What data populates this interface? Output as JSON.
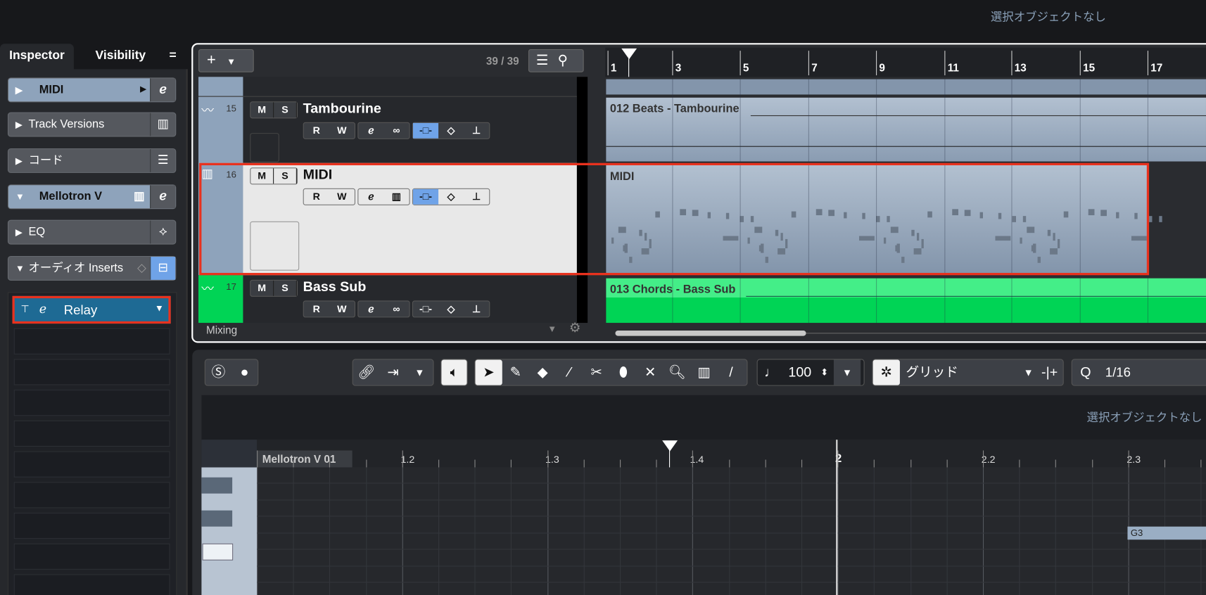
{
  "top_bar": {
    "selection_info": "選択オブジェクトなし"
  },
  "inspector": {
    "tabs": [
      {
        "label": "Inspector",
        "active": true
      },
      {
        "label": "Visibility",
        "active": false
      }
    ],
    "menu_icon": "hamburger-icon",
    "sections": [
      {
        "label": "MIDI",
        "expanded": false,
        "icon": "edit-e-icon"
      },
      {
        "label": "Track Versions",
        "expanded": false,
        "icon": "track-versions-icon"
      },
      {
        "label": "コード",
        "expanded": false,
        "icon": "chord-sliders-icon"
      },
      {
        "label": "Mellotron V",
        "expanded": true,
        "icon": "edit-e-icon"
      },
      {
        "label": "EQ",
        "expanded": false,
        "icon": "eq-icon"
      },
      {
        "label": "オーディオ Inserts",
        "expanded": true,
        "icon": "insert-icon"
      }
    ],
    "insert_slot": {
      "label": "Relay"
    }
  },
  "project": {
    "add_button": "+",
    "track_count": "39 / 39",
    "tracks": [
      {
        "number": "15",
        "name": "Tambourine",
        "type": "audio",
        "event": "012 Beats - Tambourine"
      },
      {
        "number": "16",
        "name": "MIDI",
        "type": "instrument",
        "event": "MIDI",
        "selected": true
      },
      {
        "number": "17",
        "name": "Bass Sub",
        "type": "audio",
        "event": "013 Chords - Bass Sub",
        "color": "#00d455"
      }
    ],
    "buttons": {
      "mute": "M",
      "solo": "S",
      "read": "R",
      "write": "W"
    },
    "ruler": [
      "1",
      "3",
      "5",
      "7",
      "9",
      "11",
      "13",
      "15",
      "17"
    ],
    "footer": "Mixing"
  },
  "editor": {
    "velocity": "100",
    "snap_type": "グリッド",
    "quantize_label": "Q",
    "quantize": "1/16",
    "selection_info": "選択オブジェクトなし",
    "part_name": "Mellotron V 01",
    "ruler": [
      "1.2",
      "1.3",
      "1.4",
      "2",
      "2.2",
      "2.3"
    ],
    "note": "G3"
  },
  "colors": {
    "accent_blue": "#6fa3e8",
    "insert_blue": "#1e6a94",
    "highlight_red": "#e8321e",
    "green_track": "#00d455"
  }
}
